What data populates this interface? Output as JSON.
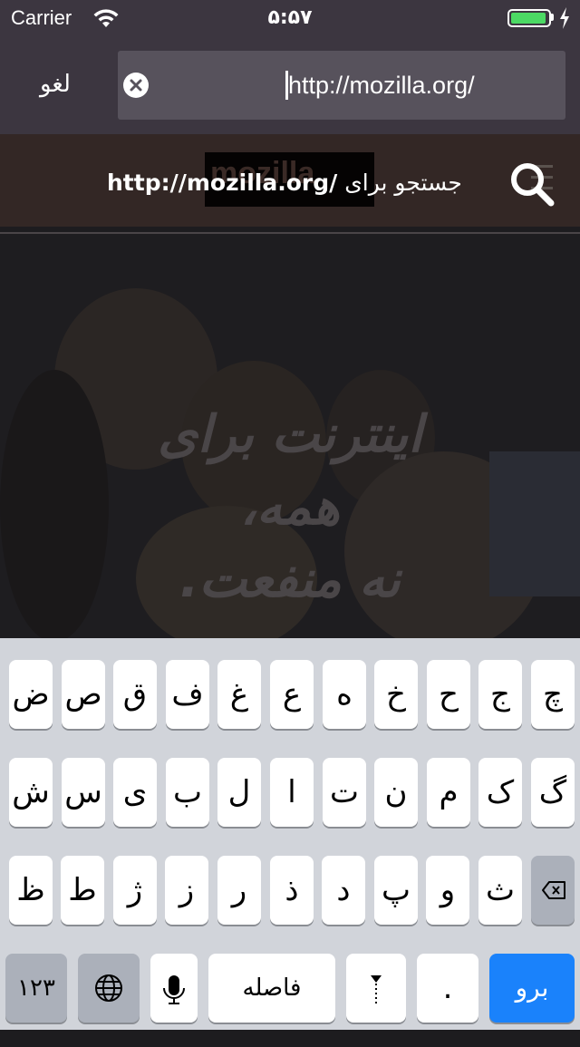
{
  "status_bar": {
    "carrier": "Carrier",
    "time": "۵:۵۷",
    "battery_level": 0.95
  },
  "url_bar": {
    "cancel_label": "لغو",
    "url_value": "http://mozilla.org/"
  },
  "suggestion": {
    "prefix": "جستجو برای",
    "query": "http://mozilla.org/",
    "ghost_logo": "mozilla"
  },
  "page": {
    "headline_1": "اینترنت برای",
    "headline_2": "همه،",
    "headline_3": "نه منفعت."
  },
  "keyboard": {
    "row1": [
      "چ",
      "ج",
      "ح",
      "خ",
      "ه",
      "ع",
      "غ",
      "ف",
      "ق",
      "ص",
      "ض"
    ],
    "row2": [
      "گ",
      "ک",
      "م",
      "ن",
      "ت",
      "ا",
      "ل",
      "ب",
      "ی",
      "س",
      "ش"
    ],
    "row3": [
      "ث",
      "و",
      "پ",
      "د",
      "ذ",
      "ر",
      "ز",
      "ژ",
      "ط",
      "ظ"
    ],
    "numbers_label": "۱۲۳",
    "space_label": "فاصله",
    "dot_label": ".",
    "go_label": "برو"
  },
  "colors": {
    "accent": "#1a82fb",
    "battery": "#4cd964",
    "toolbar": "#3c3640"
  }
}
